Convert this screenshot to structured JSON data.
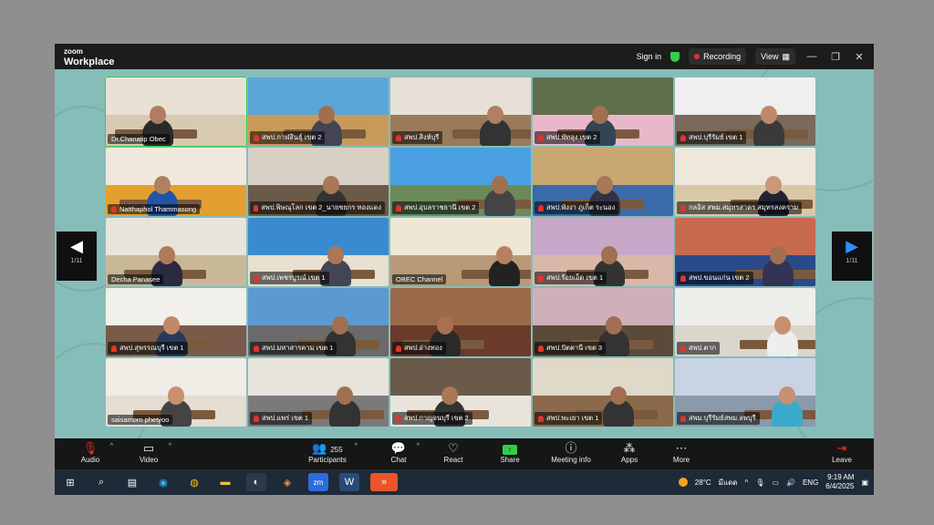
{
  "app": {
    "brand_top": "zoom",
    "brand_bottom": "Workplace"
  },
  "titlebar": {
    "sign_in": "Sign in",
    "recording": "Recording",
    "view": "View"
  },
  "pager": {
    "left": "1/11",
    "right": "1/11"
  },
  "tiles": [
    {
      "name": "Dr.Chanatip Obec",
      "muted": false,
      "active": true,
      "c1": "#e9e2d4",
      "c2": "#d8cab0",
      "skin": "#b07d60",
      "cloth": "#2a2a2a"
    },
    {
      "name": "สพป.กาฬสินธุ์ เขต 2",
      "muted": true,
      "active": false,
      "c1": "#5aa6d8",
      "c2": "#c89a5a",
      "skin": "#a0704e",
      "cloth": "#445"
    },
    {
      "name": "สพป.สิงห์บุรี",
      "muted": true,
      "active": false,
      "c1": "#e6e0d6",
      "c2": "#9a7a5a",
      "skin": "#b08060",
      "cloth": "#333"
    },
    {
      "name": "สพป.พัทลุง เขต 2",
      "muted": true,
      "active": false,
      "c1": "#5f6d4a",
      "c2": "#e8b8c8",
      "skin": "#a07050",
      "cloth": "#345"
    },
    {
      "name": "สพป.บุรีรัมย์ เขต 1",
      "muted": true,
      "active": false,
      "c1": "#efefef",
      "c2": "#7a6a5a",
      "skin": "#c08a6a",
      "cloth": "#3a3a3a"
    },
    {
      "name": "Natthaphol Thammasong",
      "muted": true,
      "active": false,
      "c1": "#f0e8dc",
      "c2": "#e3a030",
      "skin": "#b08060",
      "cloth": "#2255aa"
    },
    {
      "name": "สพป.พิษณุโลก เขต 2_นายชยกร ทองแดง",
      "muted": true,
      "active": false,
      "c1": "#d8d0c4",
      "c2": "#6a5a4a",
      "skin": "#a87858",
      "cloth": "#333"
    },
    {
      "name": "สพป.อุบลราชธานี เขต 2",
      "muted": true,
      "active": false,
      "c1": "#4aa0e0",
      "c2": "#6a8a5a",
      "skin": "#a07050",
      "cloth": "#444"
    },
    {
      "name": "สพป.พังงา ภูเก็ต ระนอง",
      "muted": true,
      "active": false,
      "c1": "#c8a870",
      "c2": "#3a6aa8",
      "skin": "#a87858",
      "cloth": "#334"
    },
    {
      "name": "กลอิส สพม.สมุทรสาคร สมุทรสงคราม",
      "muted": true,
      "active": false,
      "c1": "#eee8dc",
      "c2": "#d8c8a8",
      "skin": "#c89878",
      "cloth": "#223"
    },
    {
      "name": "Decha Panasee",
      "muted": false,
      "active": false,
      "c1": "#e8e4dc",
      "c2": "#c8b898",
      "skin": "#b07a58",
      "cloth": "#2a2a40"
    },
    {
      "name": "สพป.เพชรบูรณ์ เขต 1",
      "muted": true,
      "active": false,
      "c1": "#3a8ad0",
      "c2": "#e8e0d0",
      "skin": "#a87858",
      "cloth": "#445"
    },
    {
      "name": "OBEC Channel",
      "muted": false,
      "active": false,
      "c1": "#efe6d6",
      "c2": "#b89a78",
      "skin": "#b88060",
      "cloth": "#222"
    },
    {
      "name": "สพป.ร้อยเอ็ด เขต 1",
      "muted": true,
      "active": false,
      "c1": "#c8a8c8",
      "c2": "#d8b8a8",
      "skin": "#a07050",
      "cloth": "#333"
    },
    {
      "name": "สพป.ขอนแก่น เขต 2",
      "muted": true,
      "active": false,
      "c1": "#c86a50",
      "c2": "#2a4a8a",
      "skin": "#a07050",
      "cloth": "#335"
    },
    {
      "name": "สพป.สุพรรณบุรี เขต 1",
      "muted": true,
      "active": false,
      "c1": "#f2f0ea",
      "c2": "#7a5a4a",
      "skin": "#c08a6a",
      "cloth": "#2a3a5a"
    },
    {
      "name": "สพป.มหาสารคาม เขต 1",
      "muted": true,
      "active": false,
      "c1": "#5a9ad0",
      "c2": "#6a6a6a",
      "skin": "#a07050",
      "cloth": "#333"
    },
    {
      "name": "สพป.อ่างทอง",
      "muted": true,
      "active": false,
      "c1": "#9a6a4a",
      "c2": "#6a3a2a",
      "skin": "#a87050",
      "cloth": "#2a2a2a"
    },
    {
      "name": "สพป.ปัตตานี เขต 3",
      "muted": true,
      "active": false,
      "c1": "#d0b0b8",
      "c2": "#5a4a3a",
      "skin": "#a07050",
      "cloth": "#333"
    },
    {
      "name": "สพป.ตาก",
      "muted": true,
      "active": false,
      "c1": "#eeeeea",
      "c2": "#dad6cc",
      "skin": "#c89070",
      "cloth": "#eeeeee"
    },
    {
      "name": "saisamorn  phetyoo",
      "muted": false,
      "active": false,
      "c1": "#f0ece6",
      "c2": "#e4ddd2",
      "skin": "#c89070",
      "cloth": "#444"
    },
    {
      "name": "สพป.แพร่ เขต 1",
      "muted": true,
      "active": false,
      "c1": "#e8e4dc",
      "c2": "#7a7a7a",
      "skin": "#a07050",
      "cloth": "#333"
    },
    {
      "name": "สพป.กาญจนบุรี เขต 2",
      "muted": true,
      "active": false,
      "c1": "#6a5a4a",
      "c2": "#e8e4dc",
      "skin": "#a87858",
      "cloth": "#333"
    },
    {
      "name": "สพป.พะเยา เขต 1",
      "muted": true,
      "active": false,
      "c1": "#e0d8c8",
      "c2": "#8a6a4a",
      "skin": "#a07050",
      "cloth": "#333"
    },
    {
      "name": "สพม.บุรีรัมย์สพม.ลพบุรี",
      "muted": true,
      "active": false,
      "c1": "#c8d4e4",
      "c2": "#8a9aaa",
      "skin": "#c89070",
      "cloth": "#3aaacc"
    }
  ],
  "toolbar": {
    "audio": "Audio",
    "video": "Video",
    "participants": "Participants",
    "participants_count": "255",
    "chat": "Chat",
    "react": "React",
    "share": "Share",
    "meeting_info": "Meeting info",
    "apps": "Apps",
    "more": "More",
    "leave": "Leave"
  },
  "taskbar": {
    "temp": "28°C",
    "weather": "มีแดด",
    "lang": "ENG",
    "time": "9:19 AM",
    "date": "6/4/2025",
    "app_zm": "zm"
  },
  "colors": {
    "active_outline": "#2fd04a",
    "share_green": "#2fd04a",
    "leave_red": "#e0342c"
  }
}
